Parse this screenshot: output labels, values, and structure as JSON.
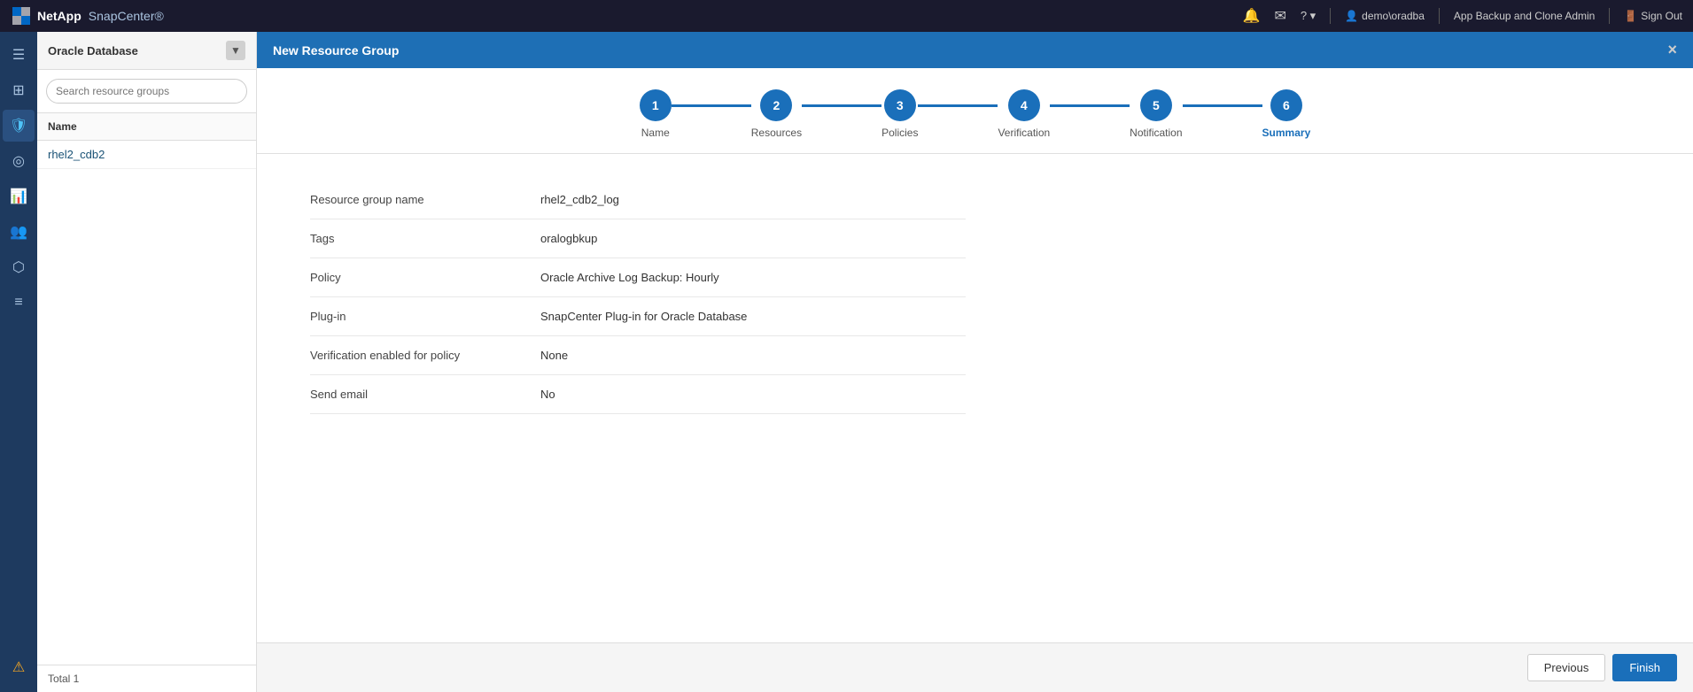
{
  "topNav": {
    "brand": "NetApp",
    "appName": "SnapCenter®",
    "icons": {
      "bell": "🔔",
      "mail": "✉",
      "help": "?"
    },
    "user": "demo\\oradba",
    "role": "App Backup and Clone Admin",
    "signout": "Sign Out"
  },
  "sideIcons": [
    {
      "id": "menu",
      "icon": "☰",
      "active": false
    },
    {
      "id": "grid",
      "icon": "⊞",
      "active": false
    },
    {
      "id": "shield",
      "icon": "🛡",
      "active": true
    },
    {
      "id": "circle",
      "icon": "◎",
      "active": false
    },
    {
      "id": "chart",
      "icon": "📊",
      "active": false
    },
    {
      "id": "people",
      "icon": "👥",
      "active": false
    },
    {
      "id": "topology",
      "icon": "⬡",
      "active": false
    },
    {
      "id": "settings",
      "icon": "≡",
      "active": false
    },
    {
      "id": "alert",
      "icon": "⚠",
      "active": false
    }
  ],
  "leftPanel": {
    "title": "Oracle Database",
    "searchPlaceholder": "Search resource groups",
    "listHeader": "Name",
    "items": [
      "rhel2_cdb2"
    ],
    "footer": "Total 1"
  },
  "dialog": {
    "title": "New Resource Group",
    "closeLabel": "×"
  },
  "wizard": {
    "steps": [
      {
        "number": "1",
        "label": "Name",
        "active": false
      },
      {
        "number": "2",
        "label": "Resources",
        "active": false
      },
      {
        "number": "3",
        "label": "Policies",
        "active": false
      },
      {
        "number": "4",
        "label": "Verification",
        "active": false
      },
      {
        "number": "5",
        "label": "Notification",
        "active": false
      },
      {
        "number": "6",
        "label": "Summary",
        "active": true
      }
    ]
  },
  "summary": {
    "title": "Summary",
    "fields": [
      {
        "label": "Resource group name",
        "value": "rhel2_cdb2_log"
      },
      {
        "label": "Tags",
        "value": "oralogbkup"
      },
      {
        "label": "Policy",
        "value": "Oracle Archive Log Backup: Hourly"
      },
      {
        "label": "Plug-in",
        "value": "SnapCenter Plug-in for Oracle Database"
      },
      {
        "label": "Verification enabled for policy",
        "value": "None"
      },
      {
        "label": "Send email",
        "value": "No"
      }
    ]
  },
  "footer": {
    "previousLabel": "Previous",
    "finishLabel": "Finish"
  }
}
